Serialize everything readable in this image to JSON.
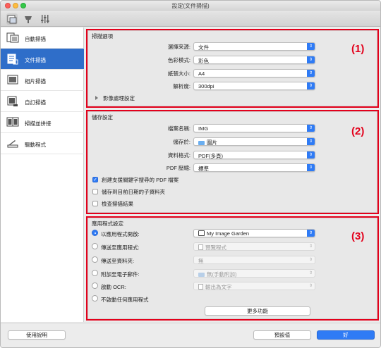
{
  "window": {
    "title": "設定(文件掃描)"
  },
  "toolbar": {
    "icons": [
      "scan-settings-icon",
      "general-settings-icon",
      "advanced-settings-icon"
    ]
  },
  "sidebar": {
    "items": [
      {
        "label": "自動掃描",
        "active": false
      },
      {
        "label": "文件掃描",
        "active": true
      },
      {
        "label": "相片掃描",
        "active": false
      },
      {
        "label": "自訂掃描",
        "active": false
      },
      {
        "label": "掃描並拼接",
        "active": false
      },
      {
        "label": "驅動程式",
        "active": false
      }
    ]
  },
  "scan_options": {
    "title": "掃描選項",
    "marker": "(1)",
    "source_label": "選擇來源:",
    "source_value": "文件",
    "color_label": "色彩模式:",
    "color_value": "彩色",
    "paper_label": "紙張大小:",
    "paper_value": "A4",
    "resolution_label": "解析度:",
    "resolution_value": "300dpi",
    "image_processing": "影像處理設定"
  },
  "save_settings": {
    "title": "儲存設定",
    "marker": "(2)",
    "filename_label": "檔案名稱:",
    "filename_value": "IMG",
    "savein_label": "儲存於:",
    "savein_value": "圖片",
    "format_label": "資料格式:",
    "format_value": "PDF(多頁)",
    "compression_label": "PDF 壓縮:",
    "compression_value": "標準",
    "checkbox_keyword": "創建支援關鍵字搜尋的 PDF 檔案",
    "checkbox_subfolder": "儲存到目前日期的子資料夾",
    "checkbox_check": "檢查掃描結果"
  },
  "app_settings": {
    "title": "應用程式設定",
    "marker": "(3)",
    "open_app_label": "以應用程式開啟:",
    "open_app_value": "My Image Garden",
    "send_app_label": "傳送至應用程式:",
    "send_app_value": "預覽程式",
    "send_folder_label": "傳送至資料夾:",
    "send_folder_value": "無",
    "attach_email_label": "附加至電子郵件:",
    "attach_email_value": "無(手動附加)",
    "start_ocr_label": "啟動 OCR:",
    "start_ocr_value": "輸出為文字",
    "no_app_label": "不啟動任何應用程式",
    "more_functions": "更多功能"
  },
  "footer": {
    "help": "使用說明",
    "defaults": "預設值",
    "ok": "好"
  }
}
